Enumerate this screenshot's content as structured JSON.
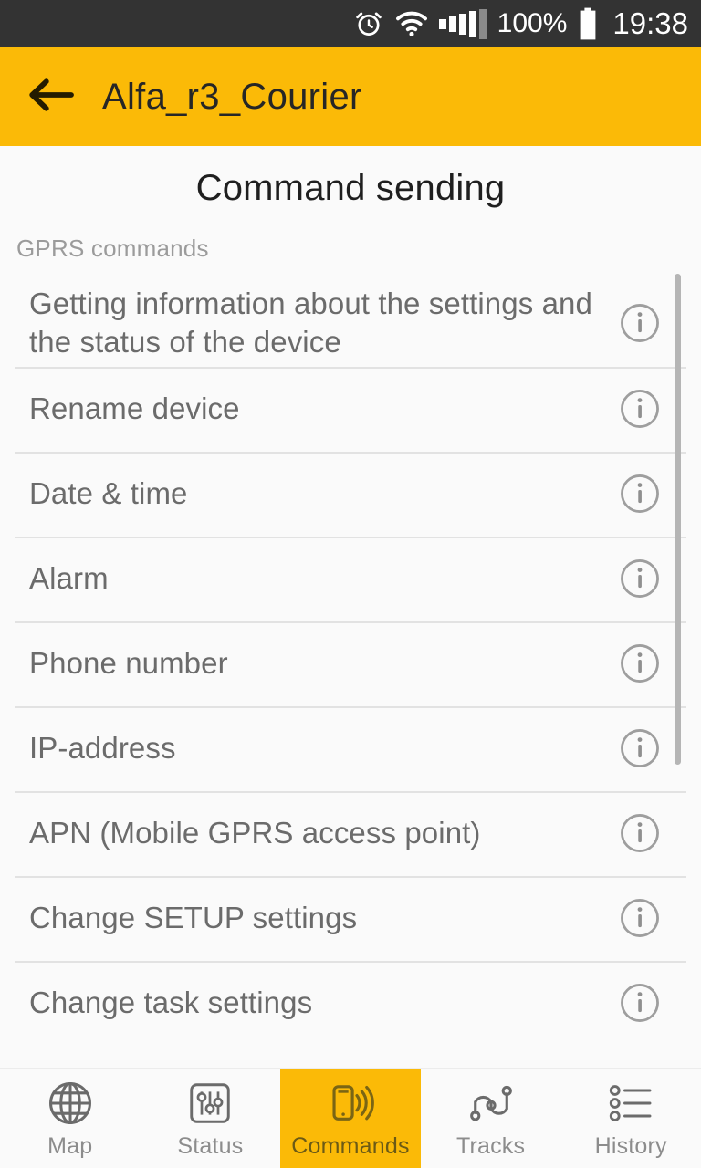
{
  "status_bar": {
    "alarm_icon": "alarm-clock-icon",
    "wifi_icon": "wifi-icon",
    "signal_icon": "cellular-signal-icon",
    "battery_percent": "100%",
    "battery_icon": "battery-full-icon",
    "time": "19:38"
  },
  "app_bar": {
    "back_icon": "back-arrow-icon",
    "title": "Alfa_r3_Courier",
    "background_color": "#fbba07"
  },
  "page": {
    "title": "Command sending",
    "section_label": "GPRS commands"
  },
  "commands": [
    {
      "label": "Getting information about the settings and the status of the device",
      "info_icon": "info-icon"
    },
    {
      "label": "Rename device",
      "info_icon": "info-icon"
    },
    {
      "label": "Date & time",
      "info_icon": "info-icon"
    },
    {
      "label": "Alarm",
      "info_icon": "info-icon"
    },
    {
      "label": "Phone number",
      "info_icon": "info-icon"
    },
    {
      "label": "IP-address",
      "info_icon": "info-icon"
    },
    {
      "label": "APN (Mobile GPRS access point)",
      "info_icon": "info-icon"
    },
    {
      "label": "Change SETUP settings",
      "info_icon": "info-icon"
    },
    {
      "label": "Change task settings",
      "info_icon": "info-icon"
    }
  ],
  "bottom_nav": {
    "active_index": 2,
    "active_color": "#fbba07",
    "items": [
      {
        "label": "Map",
        "icon": "globe-icon"
      },
      {
        "label": "Status",
        "icon": "sliders-icon"
      },
      {
        "label": "Commands",
        "icon": "phone-signal-icon"
      },
      {
        "label": "Tracks",
        "icon": "route-icon"
      },
      {
        "label": "History",
        "icon": "list-icon"
      }
    ]
  }
}
